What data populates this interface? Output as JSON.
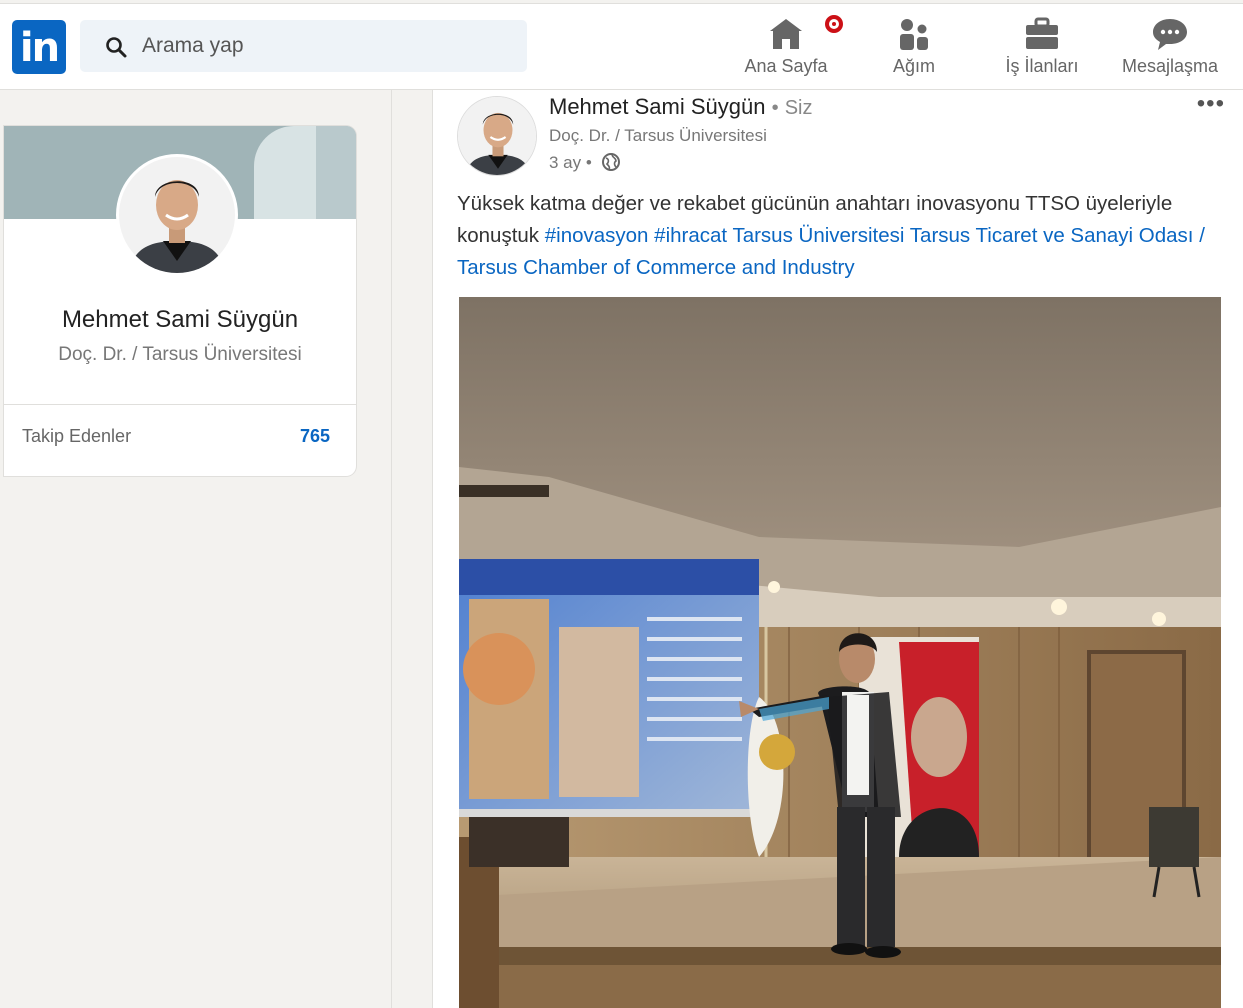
{
  "nav": {
    "search_placeholder": "Arama yap",
    "items": [
      {
        "label": "Ana Sayfa",
        "icon": "home-icon"
      },
      {
        "label": "Ağım",
        "icon": "network-icon"
      },
      {
        "label": "İş İlanları",
        "icon": "briefcase-icon"
      },
      {
        "label": "Mesajlaşma",
        "icon": "messaging-icon"
      }
    ]
  },
  "profile": {
    "name": "Mehmet Sami Süygün",
    "headline": "Doç. Dr. / Tarsus Üniversitesi",
    "followers_label": "Takip Edenler",
    "followers_count": "765"
  },
  "post": {
    "author": "Mehmet Sami Süygün",
    "separator": "•",
    "you_label": "Siz",
    "headline": "Doç. Dr. / Tarsus Üniversitesi",
    "time": "3 ay •",
    "more": "•••",
    "text_plain": "Yüksek katma değer ve rekabet gücünün anahtarı inovasyonu TTSO üyeleriyle konuştuk ",
    "tags": [
      "#inovasyon",
      "#ihracat",
      "Tarsus Üniversitesi",
      "Tarsus Ticaret ve Sanayi Odası / Tarsus Chamber of Commerce and Industry"
    ]
  },
  "colors": {
    "brand": "#0a66c2",
    "notification": "#cc1016",
    "background": "#f3f2ef"
  }
}
